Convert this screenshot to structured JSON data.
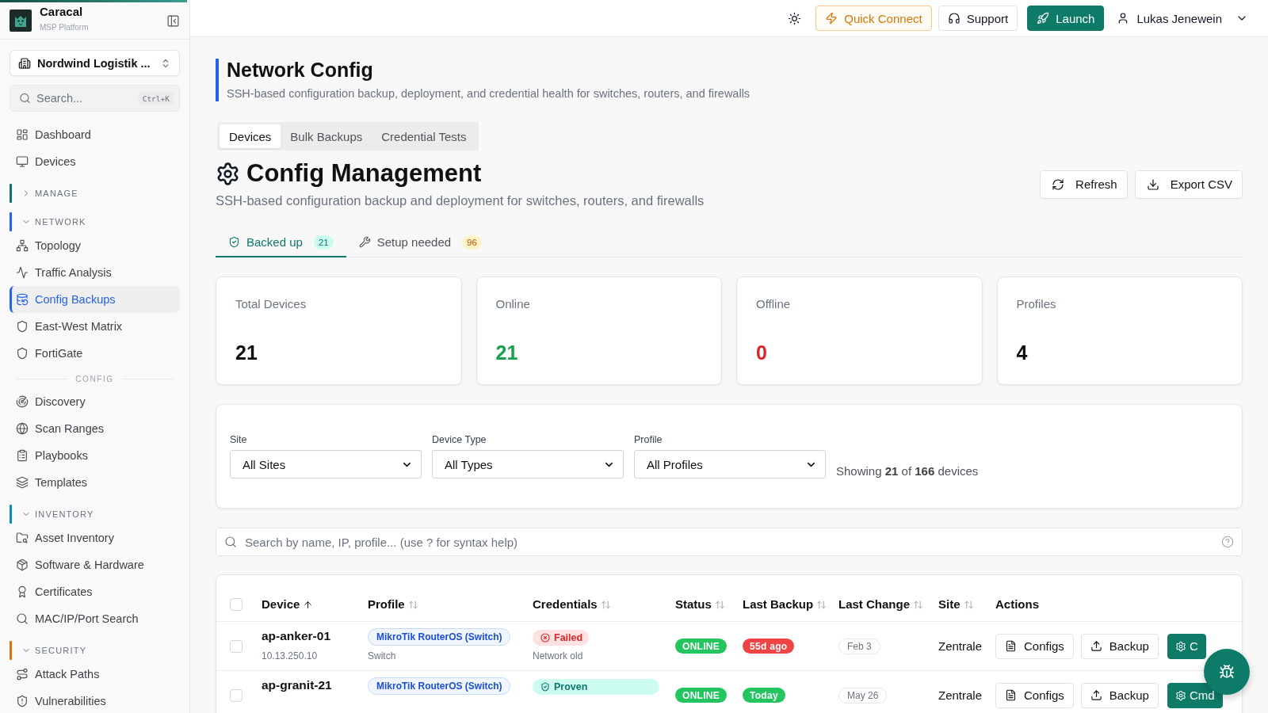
{
  "sidebar": {
    "brand": {
      "name": "Caracal",
      "tagline": "MSP Platform"
    },
    "org_selector": {
      "value": "Nordwind Logistik ..."
    },
    "search": {
      "placeholder": "Search...",
      "shortcut": "Ctrl+K"
    },
    "nav": [
      {
        "kind": "link",
        "label": "Dashboard",
        "selected": false
      },
      {
        "kind": "link",
        "label": "Devices",
        "selected": false
      },
      {
        "kind": "group",
        "label": "MANAGE",
        "expanded": false,
        "color": "#0f766e"
      },
      {
        "kind": "group",
        "label": "NETWORK",
        "expanded": true,
        "color": "#2563eb",
        "children": [
          {
            "kind": "link",
            "label": "Topology",
            "selected": false
          },
          {
            "kind": "link",
            "label": "Traffic Analysis",
            "selected": false
          },
          {
            "kind": "link",
            "label": "Config Backups",
            "selected": true
          },
          {
            "kind": "link",
            "label": "East-West Matrix",
            "selected": false
          },
          {
            "kind": "link",
            "label": "FortiGate",
            "selected": false
          },
          {
            "kind": "heading",
            "label": "CONFIG"
          },
          {
            "kind": "link",
            "label": "Discovery",
            "selected": false
          },
          {
            "kind": "link",
            "label": "Scan Ranges",
            "selected": false
          },
          {
            "kind": "link",
            "label": "Playbooks",
            "selected": false
          },
          {
            "kind": "link",
            "label": "Templates",
            "selected": false
          }
        ]
      },
      {
        "kind": "group",
        "label": "INVENTORY",
        "expanded": true,
        "color": "#0891b2",
        "children": [
          {
            "kind": "link",
            "label": "Asset Inventory",
            "selected": false
          },
          {
            "kind": "link",
            "label": "Software & Hardware",
            "selected": false
          },
          {
            "kind": "link",
            "label": "Certificates",
            "selected": false
          },
          {
            "kind": "link",
            "label": "MAC/IP/Port Search",
            "selected": false
          }
        ]
      },
      {
        "kind": "group",
        "label": "SECURITY",
        "expanded": true,
        "color": "#d97706",
        "children": [
          {
            "kind": "link",
            "label": "Attack Paths",
            "selected": false
          },
          {
            "kind": "link",
            "label": "Vulnerabilities",
            "selected": false
          }
        ]
      }
    ]
  },
  "topbar": {
    "buttons": [
      {
        "kind": "warning",
        "label": "Quick Connect"
      },
      {
        "kind": "outline",
        "label": "Support"
      },
      {
        "kind": "primary",
        "label": "Launch"
      }
    ],
    "user": {
      "name": "Lukas Jenewein"
    }
  },
  "page_header": {
    "title": "Network Config",
    "subtitle": "SSH-based configuration backup, deployment, and credential health for switches, routers, and firewalls"
  },
  "tabs": [
    {
      "label": "Devices",
      "selected": true
    },
    {
      "label": "Bulk Backups",
      "selected": false
    },
    {
      "label": "Credential Tests",
      "selected": false
    }
  ],
  "section": {
    "title": "Config Management",
    "subtitle": "SSH-based configuration backup and deployment for switches, routers, and firewalls",
    "actions": [
      {
        "label": "Refresh"
      },
      {
        "label": "Export CSV"
      }
    ]
  },
  "status_tabs": [
    {
      "label": "Backed up",
      "count": "21",
      "kind": "success",
      "selected": true
    },
    {
      "label": "Setup needed",
      "count": "96",
      "kind": "warning",
      "selected": false
    }
  ],
  "stats": [
    {
      "label": "Total Devices",
      "value": "21",
      "kind": "neutral"
    },
    {
      "label": "Online",
      "value": "21",
      "kind": "good"
    },
    {
      "label": "Offline",
      "value": "0",
      "kind": "bad"
    },
    {
      "label": "Profiles",
      "value": "4",
      "kind": "neutral"
    }
  ],
  "filters": {
    "fields": [
      {
        "label": "Site",
        "value": "All Sites"
      },
      {
        "label": "Device Type",
        "value": "All Types"
      },
      {
        "label": "Profile",
        "value": "All Profiles"
      }
    ],
    "summary": "Showing **21** of **166** devices"
  },
  "search": {
    "placeholder": "Search by name, IP, profile... (use ? for syntax help)"
  },
  "table": {
    "select_all": {
      "checked": false
    },
    "columns": [
      {
        "label": "Device",
        "sortable": true,
        "sorted": true
      },
      {
        "label": "Profile",
        "sortable": true,
        "sorted": false
      },
      {
        "label": "Credentials",
        "sortable": true,
        "sorted": false
      },
      {
        "label": "Status",
        "sortable": true,
        "sorted": false
      },
      {
        "label": "Last Backup",
        "sortable": true,
        "sorted": false
      },
      {
        "label": "Last Change",
        "sortable": true,
        "sorted": false
      },
      {
        "label": "Site",
        "sortable": true,
        "sorted": false
      },
      {
        "label": "Actions",
        "sortable": false,
        "sorted": false
      }
    ],
    "rows": [
      {
        "selected": false,
        "device": "ap-anker-01",
        "ip": "10.13.250.10",
        "profile": "MikroTik RouterOS (Switch)",
        "type": "Switch",
        "credentials": {
          "kind": "failed",
          "label": "Failed",
          "note": "Network old"
        },
        "status": {
          "kind": "online",
          "label": "ONLINE"
        },
        "last_backup": {
          "kind": "stale",
          "label": "55d ago"
        },
        "last_change": "Feb 3",
        "site": "Zentrale",
        "actions": [
          {
            "kind": "configs",
            "label": "Configs"
          },
          {
            "kind": "backup",
            "label": "Backup"
          },
          {
            "kind": "command",
            "label": "C"
          }
        ]
      },
      {
        "selected": false,
        "device": "ap-granit-21",
        "profile": "MikroTik RouterOS (Switch)",
        "credentials": {
          "kind": "proven",
          "label": "Proven"
        },
        "status": {
          "kind": "online",
          "label": "ONLINE"
        },
        "last_backup": {
          "kind": "fresh",
          "label": "Today"
        },
        "last_change": "May 26",
        "site": "Zentrale",
        "actions": [
          {
            "kind": "configs",
            "label": "Configs"
          },
          {
            "kind": "backup",
            "label": "Backup"
          },
          {
            "kind": "command",
            "label": "Cmd"
          }
        ]
      }
    ]
  }
}
